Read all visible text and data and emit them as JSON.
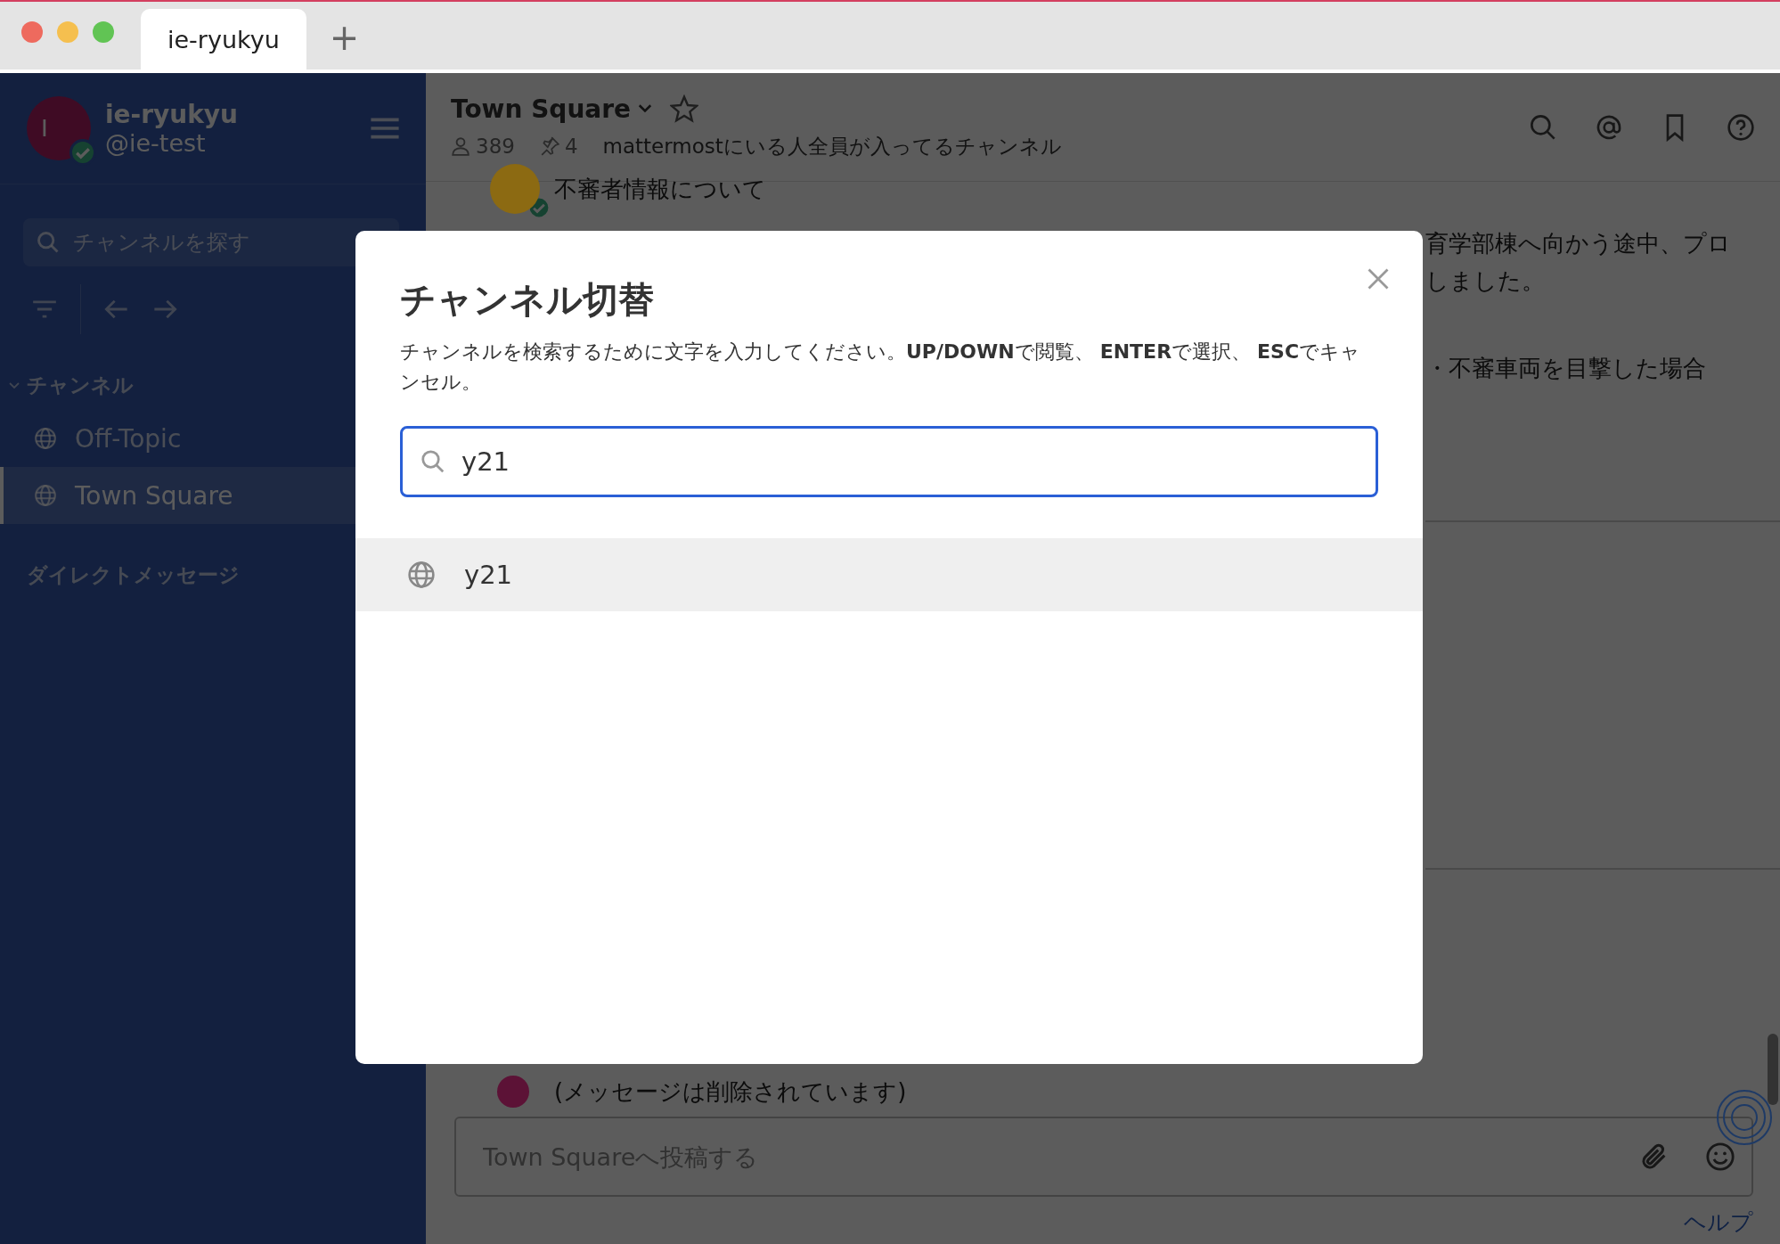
{
  "browser": {
    "tabs": [
      {
        "label": "ie-ryukyu",
        "selected": true
      }
    ],
    "new_tab": "+"
  },
  "sidebar": {
    "team": "ie-ryukyu",
    "username": "@ie-test",
    "avatar_initial": "I",
    "online": true,
    "search_placeholder": "チャンネルを探す",
    "sections": [
      {
        "title": "チャンネル",
        "expanded": true,
        "items": [
          {
            "label": "Off-Topic",
            "selected": false
          },
          {
            "label": "Town Square",
            "selected": true
          }
        ]
      },
      {
        "title": "ダイレクトメッセージ"
      }
    ]
  },
  "channel_header": {
    "name": "Town Square",
    "members": "389",
    "pinned": "4",
    "purpose": "mattermostにいる人全員が入ってるチャンネル"
  },
  "posts": [
    {
      "kind": "header",
      "text": "不審者情報について",
      "color": "#8c6a12"
    },
    {
      "kind": "fragment",
      "text": "育学部棟へ向かう途中、プロ"
    },
    {
      "kind": "fragment",
      "text": "しました。"
    },
    {
      "kind": "gap-fragment",
      "text": "・不審車両を目撃した場合"
    },
    {
      "kind": "deleted",
      "text": "(メッセージは削除されています)",
      "color": "#5c1236"
    }
  ],
  "composer": {
    "placeholder": "Town Squareへ投稿する"
  },
  "help_link": "ヘルプ",
  "modal": {
    "title": "チャンネル切替",
    "description": "チャンネルを検索するために文字を入力してください。**UP/DOWN**で閲覧、 **ENTER**で選択、 **ESC**でキャンセル。",
    "search_value": "y21",
    "results": [
      {
        "label": "y21",
        "selected": true
      }
    ]
  }
}
